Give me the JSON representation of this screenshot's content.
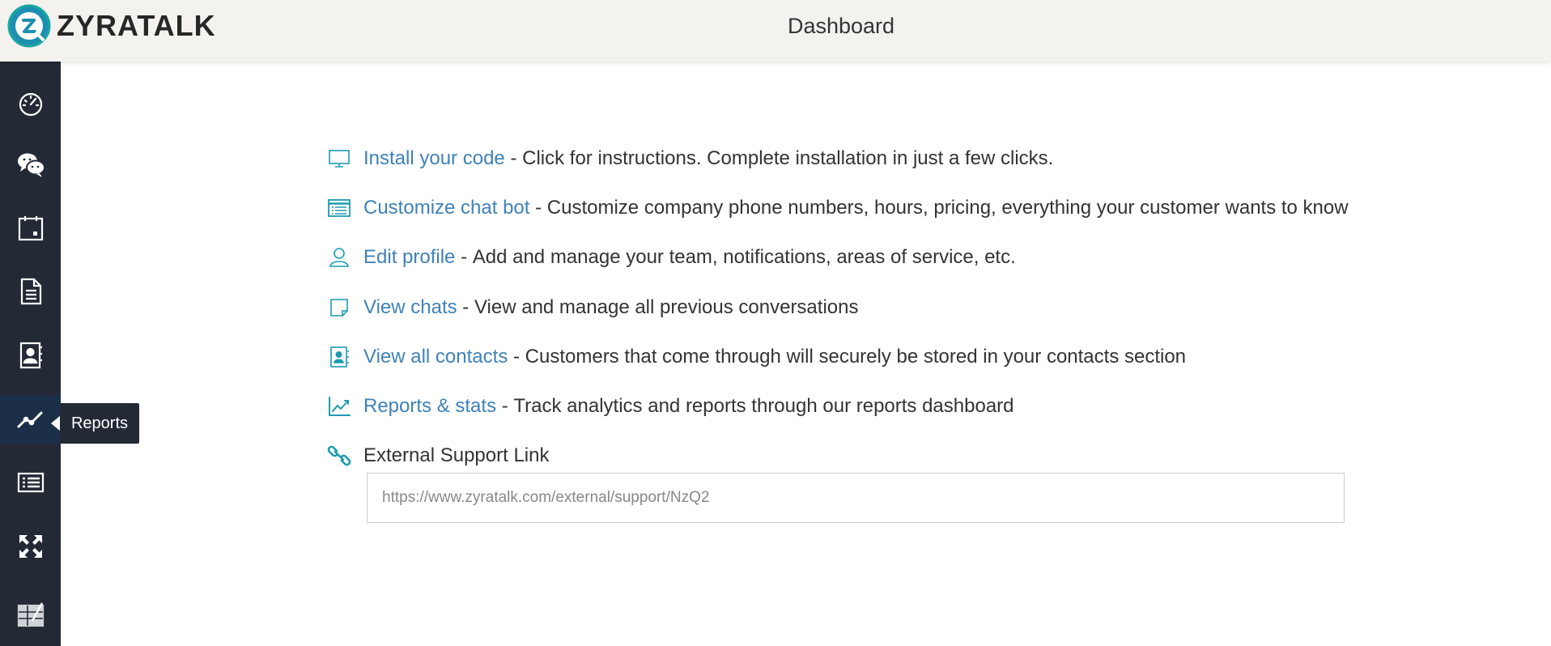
{
  "header": {
    "brand": "ZYRATALK",
    "title": "Dashboard"
  },
  "sidebar": {
    "items": [
      {
        "icon": "speedometer-icon",
        "name": "dashboard"
      },
      {
        "icon": "chat-bubbles-icon",
        "name": "chats"
      },
      {
        "icon": "calendar-icon",
        "name": "calendar"
      },
      {
        "icon": "document-icon",
        "name": "documents"
      },
      {
        "icon": "contacts-book-icon",
        "name": "contacts"
      },
      {
        "icon": "line-chart-icon",
        "name": "reports",
        "active": true
      },
      {
        "icon": "list-card-icon",
        "name": "list"
      },
      {
        "icon": "expand-arrows-icon",
        "name": "expand"
      },
      {
        "icon": "pen-table-icon",
        "name": "edit"
      }
    ],
    "tooltip": "Reports"
  },
  "main": {
    "rows": [
      {
        "icon": "monitor-icon",
        "link": "Install your code",
        "text": "Click for instructions. Complete installation in just a few clicks."
      },
      {
        "icon": "list-card-icon",
        "link": "Customize chat bot",
        "text": "Customize company phone numbers, hours, pricing, everything your customer wants to know"
      },
      {
        "icon": "user-icon",
        "link": "Edit profile",
        "text": "Add and manage your team, notifications, areas of service, etc."
      },
      {
        "icon": "note-icon",
        "link": "View chats",
        "text": "View and manage all previous conversations"
      },
      {
        "icon": "contacts-book-icon",
        "link": "View all contacts",
        "text": "Customers that come through will securely be stored in your contacts section"
      },
      {
        "icon": "line-chart-icon",
        "link": "Reports & stats",
        "text": "Track analytics and reports through our reports dashboard"
      }
    ],
    "separator": "-",
    "external": {
      "icon": "link-icon",
      "label": "External Support Link",
      "url": "https://www.zyratalk.com/external/support/NzQ2"
    }
  },
  "colors": {
    "sidebar_bg": "#232a36",
    "header_bg": "#f4f2ef",
    "link": "#3f82b8",
    "teal_icon": "#1f9bb0"
  }
}
